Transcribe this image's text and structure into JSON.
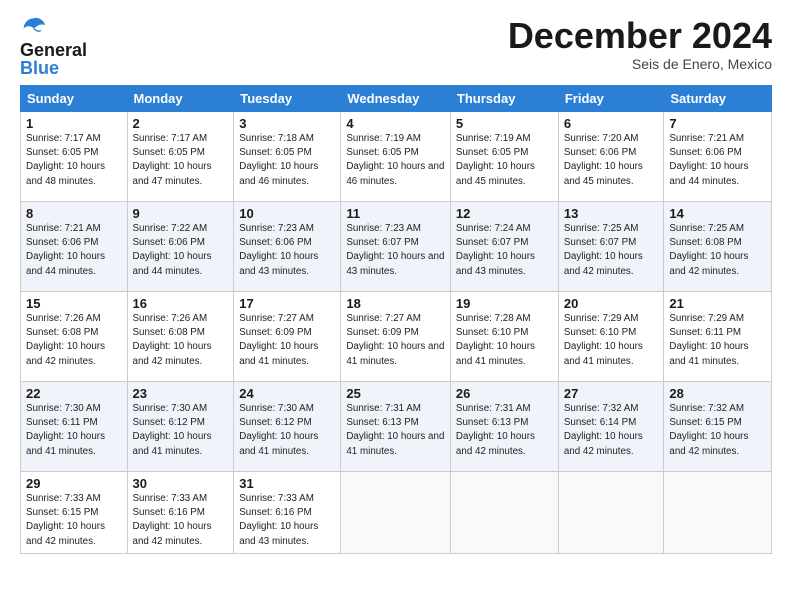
{
  "header": {
    "logo_line1": "General",
    "logo_line2": "Blue",
    "month_title": "December 2024",
    "subtitle": "Seis de Enero, Mexico"
  },
  "days_of_week": [
    "Sunday",
    "Monday",
    "Tuesday",
    "Wednesday",
    "Thursday",
    "Friday",
    "Saturday"
  ],
  "weeks": [
    [
      {
        "num": "1",
        "sunrise": "7:17 AM",
        "sunset": "6:05 PM",
        "daylight": "10 hours and 48 minutes."
      },
      {
        "num": "2",
        "sunrise": "7:17 AM",
        "sunset": "6:05 PM",
        "daylight": "10 hours and 47 minutes."
      },
      {
        "num": "3",
        "sunrise": "7:18 AM",
        "sunset": "6:05 PM",
        "daylight": "10 hours and 46 minutes."
      },
      {
        "num": "4",
        "sunrise": "7:19 AM",
        "sunset": "6:05 PM",
        "daylight": "10 hours and 46 minutes."
      },
      {
        "num": "5",
        "sunrise": "7:19 AM",
        "sunset": "6:05 PM",
        "daylight": "10 hours and 45 minutes."
      },
      {
        "num": "6",
        "sunrise": "7:20 AM",
        "sunset": "6:06 PM",
        "daylight": "10 hours and 45 minutes."
      },
      {
        "num": "7",
        "sunrise": "7:21 AM",
        "sunset": "6:06 PM",
        "daylight": "10 hours and 44 minutes."
      }
    ],
    [
      {
        "num": "8",
        "sunrise": "7:21 AM",
        "sunset": "6:06 PM",
        "daylight": "10 hours and 44 minutes."
      },
      {
        "num": "9",
        "sunrise": "7:22 AM",
        "sunset": "6:06 PM",
        "daylight": "10 hours and 44 minutes."
      },
      {
        "num": "10",
        "sunrise": "7:23 AM",
        "sunset": "6:06 PM",
        "daylight": "10 hours and 43 minutes."
      },
      {
        "num": "11",
        "sunrise": "7:23 AM",
        "sunset": "6:07 PM",
        "daylight": "10 hours and 43 minutes."
      },
      {
        "num": "12",
        "sunrise": "7:24 AM",
        "sunset": "6:07 PM",
        "daylight": "10 hours and 43 minutes."
      },
      {
        "num": "13",
        "sunrise": "7:25 AM",
        "sunset": "6:07 PM",
        "daylight": "10 hours and 42 minutes."
      },
      {
        "num": "14",
        "sunrise": "7:25 AM",
        "sunset": "6:08 PM",
        "daylight": "10 hours and 42 minutes."
      }
    ],
    [
      {
        "num": "15",
        "sunrise": "7:26 AM",
        "sunset": "6:08 PM",
        "daylight": "10 hours and 42 minutes."
      },
      {
        "num": "16",
        "sunrise": "7:26 AM",
        "sunset": "6:08 PM",
        "daylight": "10 hours and 42 minutes."
      },
      {
        "num": "17",
        "sunrise": "7:27 AM",
        "sunset": "6:09 PM",
        "daylight": "10 hours and 41 minutes."
      },
      {
        "num": "18",
        "sunrise": "7:27 AM",
        "sunset": "6:09 PM",
        "daylight": "10 hours and 41 minutes."
      },
      {
        "num": "19",
        "sunrise": "7:28 AM",
        "sunset": "6:10 PM",
        "daylight": "10 hours and 41 minutes."
      },
      {
        "num": "20",
        "sunrise": "7:29 AM",
        "sunset": "6:10 PM",
        "daylight": "10 hours and 41 minutes."
      },
      {
        "num": "21",
        "sunrise": "7:29 AM",
        "sunset": "6:11 PM",
        "daylight": "10 hours and 41 minutes."
      }
    ],
    [
      {
        "num": "22",
        "sunrise": "7:30 AM",
        "sunset": "6:11 PM",
        "daylight": "10 hours and 41 minutes."
      },
      {
        "num": "23",
        "sunrise": "7:30 AM",
        "sunset": "6:12 PM",
        "daylight": "10 hours and 41 minutes."
      },
      {
        "num": "24",
        "sunrise": "7:30 AM",
        "sunset": "6:12 PM",
        "daylight": "10 hours and 41 minutes."
      },
      {
        "num": "25",
        "sunrise": "7:31 AM",
        "sunset": "6:13 PM",
        "daylight": "10 hours and 41 minutes."
      },
      {
        "num": "26",
        "sunrise": "7:31 AM",
        "sunset": "6:13 PM",
        "daylight": "10 hours and 42 minutes."
      },
      {
        "num": "27",
        "sunrise": "7:32 AM",
        "sunset": "6:14 PM",
        "daylight": "10 hours and 42 minutes."
      },
      {
        "num": "28",
        "sunrise": "7:32 AM",
        "sunset": "6:15 PM",
        "daylight": "10 hours and 42 minutes."
      }
    ],
    [
      {
        "num": "29",
        "sunrise": "7:33 AM",
        "sunset": "6:15 PM",
        "daylight": "10 hours and 42 minutes."
      },
      {
        "num": "30",
        "sunrise": "7:33 AM",
        "sunset": "6:16 PM",
        "daylight": "10 hours and 42 minutes."
      },
      {
        "num": "31",
        "sunrise": "7:33 AM",
        "sunset": "6:16 PM",
        "daylight": "10 hours and 43 minutes."
      },
      null,
      null,
      null,
      null
    ]
  ]
}
